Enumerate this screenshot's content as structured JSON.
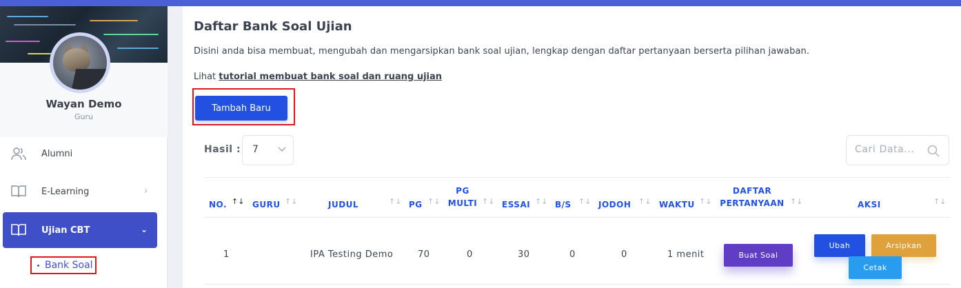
{
  "sidebar": {
    "user_name": "Wayan Demo",
    "user_role": "Guru",
    "items": [
      {
        "label": "Alumni",
        "icon": "users-icon"
      },
      {
        "label": "E-Learning",
        "icon": "book-icon"
      },
      {
        "label": "Ujian CBT",
        "icon": "book-open-icon",
        "active": true
      }
    ],
    "sub_item_label": "Bank Soal"
  },
  "page": {
    "title": "Daftar Bank Soal Ujian",
    "description": "Disini anda bisa membuat, mengubah dan mengarsipkan bank soal ujian, lengkap dengan daftar pertanyaan berserta pilihan jawaban.",
    "tutorial_prefix": "Lihat ",
    "tutorial_link": "tutorial membuat bank soal dan ruang ujian",
    "add_button": "Tambah Baru"
  },
  "table_controls": {
    "hasil_label": "Hasil :",
    "hasil_value": "7",
    "search_placeholder": "Cari Data..."
  },
  "table": {
    "headers": {
      "no": "NO.",
      "guru": "GURU",
      "judul": "JUDUL",
      "pg": "PG",
      "pg_multi_1": "PG",
      "pg_multi_2": "MULTI",
      "essai": "ESSAI",
      "bs": "B/S",
      "jodoh": "JODOH",
      "waktu": "WAKTU",
      "daftar_1": "DAFTAR",
      "daftar_2": "PERTANYAAN",
      "aksi": "AKSI"
    },
    "rows": [
      {
        "no": "1",
        "guru": "",
        "judul": "IPA Testing Demo",
        "pg": "70",
        "pg_multi": "0",
        "essai": "30",
        "bs": "0",
        "jodoh": "0",
        "waktu": "1 menit",
        "buat_soal": "Buat Soal",
        "ubah": "Ubah",
        "arsipkan": "Arsipkan",
        "cetak": "Cetak"
      }
    ]
  },
  "colors": {
    "primary": "#2250e0",
    "sidebar_active": "#3f4fc8",
    "purple": "#5f3dc4",
    "orange": "#dea13b",
    "light_blue": "#2a9cf0",
    "highlight_red": "#e0161c"
  }
}
